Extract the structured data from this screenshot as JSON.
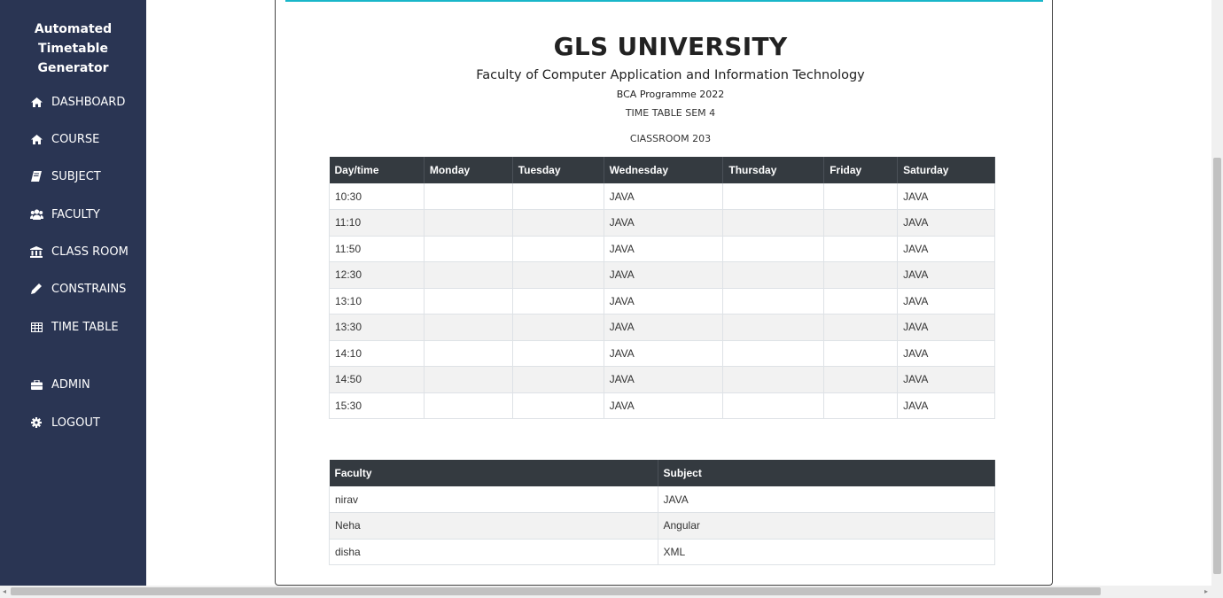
{
  "sidebar": {
    "brand_line1": "Automated Timetable",
    "brand_line2": "Generator",
    "items": [
      {
        "label": "DASHBOARD",
        "icon": "home-icon"
      },
      {
        "label": "COURSE",
        "icon": "home-icon"
      },
      {
        "label": "SUBJECT",
        "icon": "book-icon"
      },
      {
        "label": "FACULTY",
        "icon": "users-icon"
      },
      {
        "label": "CLASS ROOM",
        "icon": "bank-icon"
      },
      {
        "label": "CONSTRAINS",
        "icon": "pencil-icon"
      },
      {
        "label": "TIME TABLE",
        "icon": "table-icon"
      },
      {
        "label": "ADMIN",
        "icon": "briefcase-icon"
      },
      {
        "label": "LOGOUT",
        "icon": "gear-icon"
      }
    ]
  },
  "header": {
    "university": "GLS UNIVERSITY",
    "faculty": "Faculty of Computer Application and Information Technology",
    "programme": "BCA Programme 2022",
    "semester": "TIME TABLE SEM 4",
    "classroom": "ClASSROOM 203"
  },
  "timetable": {
    "columns": [
      "Day/time",
      "Monday",
      "Tuesday",
      "Wednesday",
      "Thursday",
      "Friday",
      "Saturday"
    ],
    "rows": [
      [
        "10:30",
        "",
        "",
        "JAVA",
        "",
        "",
        "JAVA"
      ],
      [
        "11:10",
        "",
        "",
        "JAVA",
        "",
        "",
        "JAVA"
      ],
      [
        "11:50",
        "",
        "",
        "JAVA",
        "",
        "",
        "JAVA"
      ],
      [
        "12:30",
        "",
        "",
        "JAVA",
        "",
        "",
        "JAVA"
      ],
      [
        "13:10",
        "",
        "",
        "JAVA",
        "",
        "",
        "JAVA"
      ],
      [
        "13:30",
        "",
        "",
        "JAVA",
        "",
        "",
        "JAVA"
      ],
      [
        "14:10",
        "",
        "",
        "JAVA",
        "",
        "",
        "JAVA"
      ],
      [
        "14:50",
        "",
        "",
        "JAVA",
        "",
        "",
        "JAVA"
      ],
      [
        "15:30",
        "",
        "",
        "JAVA",
        "",
        "",
        "JAVA"
      ]
    ]
  },
  "faculty_table": {
    "columns": [
      "Faculty",
      "Subject"
    ],
    "rows": [
      [
        "nirav",
        "JAVA"
      ],
      [
        "Neha",
        "Angular"
      ],
      [
        "disha",
        "XML"
      ]
    ]
  },
  "colors": {
    "sidebar_bg": "#2a3553",
    "table_header_bg": "#343a40",
    "accent": "#19b6c9"
  }
}
